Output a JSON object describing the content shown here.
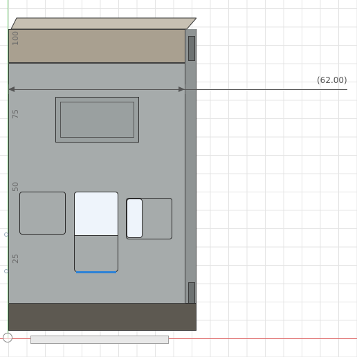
{
  "viewport": {
    "dimension": {
      "value_label": "(62.00)"
    },
    "ruler": {
      "ticks": [
        "100",
        "75",
        "50",
        "25"
      ]
    }
  },
  "colors": {
    "top_band": "#a9a090",
    "body": "#a6abab",
    "bottom_band": "#5d5951",
    "selection_edge": "#2d82d6",
    "selected_face": "#eef4fb",
    "x_axis": "#e07070",
    "y_axis": "#6fcf6f"
  },
  "icons": {
    "origin": "origin-circle-icon"
  }
}
